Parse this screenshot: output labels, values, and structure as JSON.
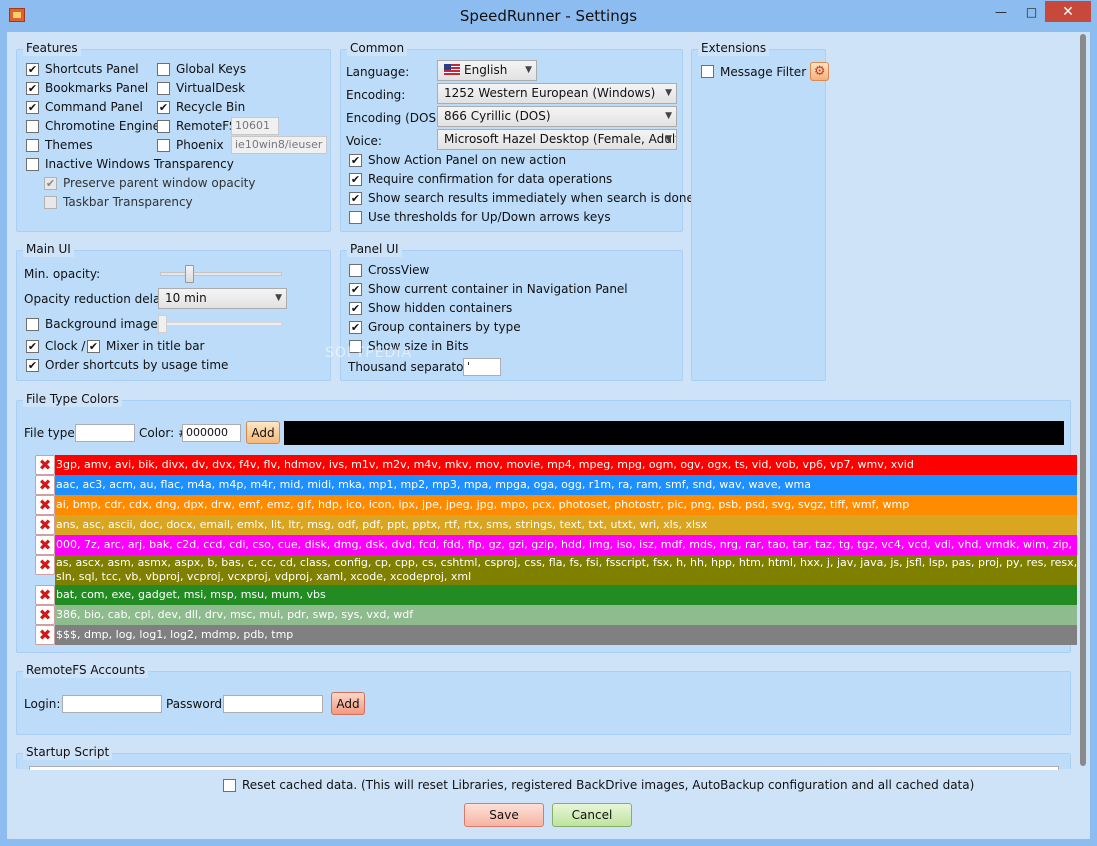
{
  "window": {
    "title": "SpeedRunner - Settings"
  },
  "features": {
    "title": "Features",
    "items": [
      {
        "label": "Shortcuts Panel",
        "checked": "✔"
      },
      {
        "label": "Bookmarks Panel",
        "checked": "✔"
      },
      {
        "label": "Command Panel",
        "checked": "✔"
      },
      {
        "label": "Chromotine Engine",
        "checked": ""
      },
      {
        "label": "Themes",
        "checked": ""
      },
      {
        "label": "Inactive Windows Transparency",
        "checked": ""
      },
      {
        "label": "Preserve parent window opacity",
        "checked": "✔"
      },
      {
        "label": "Taskbar Transparency",
        "checked": ""
      }
    ],
    "right": [
      {
        "label": "Global Keys",
        "checked": ""
      },
      {
        "label": "VirtualDesk",
        "checked": ""
      },
      {
        "label": "Recycle Bin",
        "checked": "✔"
      },
      {
        "label": "RemoteFS",
        "checked": "",
        "value": "10601"
      },
      {
        "label": "Phoenix",
        "checked": "",
        "value": "ie10win8/ieuser"
      }
    ]
  },
  "common": {
    "title": "Common",
    "language_label": "Language:",
    "language_value": "English",
    "encoding_label": "Encoding:",
    "encoding_value": "1252  Western European (Windows)",
    "encoding_dos_label": "Encoding (DOS):",
    "encoding_dos_value": "866  Cyrillic (DOS)",
    "voice_label": "Voice:",
    "voice_value": "Microsoft Hazel Desktop (Female, Adult)",
    "options": [
      {
        "label": "Show Action Panel on new action",
        "checked": "✔"
      },
      {
        "label": "Require confirmation for data operations",
        "checked": "✔"
      },
      {
        "label": "Show search results immediately when search is done",
        "checked": "✔"
      },
      {
        "label": "Use thresholds for Up/Down arrows keys",
        "checked": ""
      }
    ]
  },
  "extensions": {
    "title": "Extensions",
    "message_filter": "Message Filter",
    "message_filter_checked": ""
  },
  "main_ui": {
    "title": "Main UI",
    "min_opacity_label": "Min. opacity:",
    "min_opacity_level": 0.22,
    "opacity_delay_label": "Opacity reduction delay:",
    "opacity_delay_value": "10 min",
    "background_image_label": "Background image",
    "background_image_checked": "",
    "clock_label": "Clock /",
    "clock_checked": "✔",
    "mixer_label": "Mixer in title bar",
    "mixer_checked": "✔",
    "order_label": "Order shortcuts by usage time",
    "order_checked": "✔"
  },
  "panel_ui": {
    "title": "Panel UI",
    "options": [
      {
        "label": "CrossView",
        "checked": ""
      },
      {
        "label": "Show current container in Navigation Panel",
        "checked": "✔"
      },
      {
        "label": "Show hidden containers",
        "checked": "✔"
      },
      {
        "label": "Group containers by type",
        "checked": "✔"
      },
      {
        "label": "Show size in Bits",
        "checked": ""
      }
    ],
    "thousand_separator_label": "Thousand separator:",
    "thousand_separator_value": "'"
  },
  "file_type_colors": {
    "title": "File Type Colors",
    "file_type_label": "File type:",
    "file_type_value": "",
    "color_label": "Color: #",
    "color_value": "000000",
    "add_label": "Add",
    "preview_color": "#000000",
    "rows": [
      {
        "text": "3gp, amv, avi, bik, divx, dv, dvx, f4v, flv, hdmov, ivs, m1v, m2v, m4v, mkv, mov, movie, mp4, mpeg, mpg, ogm, ogv, ogx, ts, vid, vob, vp6, vp7, wmv, xvid",
        "color": "#ff0000",
        "text_color": "#ffffff"
      },
      {
        "text": "aac, ac3, acm, au, flac, m4a, m4p, m4r, mid, midi, mka, mp1, mp2, mp3, mpa, mpga, oga, ogg, r1m, ra, ram, smf, snd, wav, wave, wma",
        "color": "#1e90ff",
        "text_color": "#ffffff"
      },
      {
        "text": "ai, bmp, cdr, cdx, dng, dpx, drw, emf, emz, gif, hdp, ico, icon, ipx, jpe, jpeg, jpg, mpo, pcx, photoset, photostr, pic, png, psb, psd, svg, svgz, tiff, wmf, wmp",
        "color": "#ff8c00",
        "text_color": "#ffffff"
      },
      {
        "text": "ans, asc, ascii, doc, docx, email, emlx, lit, ltr, msg, odf, pdf, ppt, pptx, rtf, rtx, sms, strings, text, txt, utxt, wri, xls, xlsx",
        "color": "#daa520",
        "text_color": "#ffffff"
      },
      {
        "text": "000, 7z, arc, arj, bak, c2d, ccd, cdi, cso, cue, disk, dmg, dsk, dvd, fcd, fdd, flp, gz, gzi, gzip, hdd, img, iso, isz, mdf, mds, nrg, rar, tao, tar, taz, tg, tgz, vc4, vcd, vdi, vhd, vmdk, wim, zip, zipx",
        "color": "#ff00ff",
        "text_color": "#ffffff"
      },
      {
        "text": "as, ascx, asm, asmx, aspx, b, bas, c, cc, cd, class, config, cp, cpp, cs, cshtml, csproj, css, fla, fs, fsi, fsscript, fsx, h, hh, hpp, htm, html, hxx, j, jav, java, js, jsfl, lsp, pas, proj, py, res, resx, sln, sql, tcc, vb, vbproj, vcproj, vcxproj, vdproj, xaml, xcode, xcodeproj, xml",
        "color": "#808000",
        "text_color": "#ffffff"
      },
      {
        "text": "bat, com, exe, gadget, msi, msp, msu, mum, vbs",
        "color": "#228b22",
        "text_color": "#ffffff"
      },
      {
        "text": "386, bio, cab, cpl, dev, dll, drv, msc, mui, pdr, swp, sys, vxd, wdf",
        "color": "#8fbc8f",
        "text_color": "#ffffff"
      },
      {
        "text": "$$$, dmp, log, log1, log2, mdmp, pdb, tmp",
        "color": "#808080",
        "text_color": "#ffffff"
      }
    ]
  },
  "remotefs": {
    "title": "RemoteFS Accounts",
    "login_label": "Login:",
    "login_value": "",
    "password_label": "Password:",
    "password_value": "",
    "add_label": "Add"
  },
  "startup": {
    "title": "Startup Script"
  },
  "footer": {
    "reset_label": "Reset cached data. (This will reset Libraries, registered BackDrive images, AutoBackup configuration and all cached data)",
    "reset_checked": "",
    "save_label": "Save",
    "cancel_label": "Cancel"
  }
}
